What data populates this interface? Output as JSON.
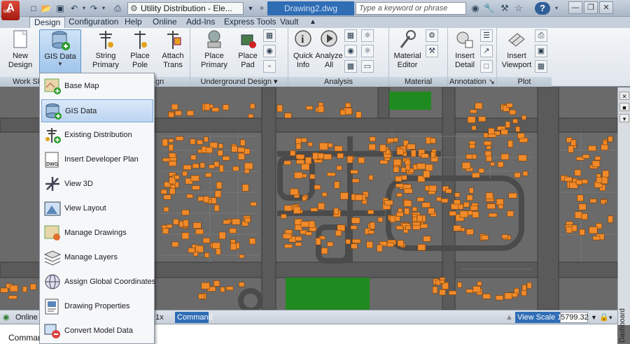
{
  "titlebar": {
    "app_initial": "A",
    "app_code": "UID",
    "file_title": "Utility Distribution - Ele...",
    "drawing_name": "Drawing2.dwg",
    "search_placeholder": "Type a keyword or phrase"
  },
  "tabs": [
    "Design",
    "Configuration",
    "Help",
    "Online",
    "Add-Ins",
    "Express Tools",
    "Vault"
  ],
  "active_tab": "Design",
  "ribbon": {
    "panels": {
      "work": "Work Sk",
      "work_tail": "gn",
      "underground": "Underground Design",
      "analysis": "Analysis",
      "material": "Material",
      "annotation": "Annotation",
      "plot": "Plot"
    },
    "buttons": {
      "new_design": [
        "New",
        "Design"
      ],
      "gis_data": "GIS Data",
      "string_primary": [
        "String",
        "Primary"
      ],
      "place_pole": [
        "Place",
        "Pole"
      ],
      "attach_trans": [
        "Attach",
        "Trans"
      ],
      "place_primary": [
        "Place",
        "Primary"
      ],
      "place_pad": [
        "Place",
        "Pad"
      ],
      "quick_info": [
        "Quick",
        "Info"
      ],
      "analyze_all": [
        "Analyze",
        "All"
      ],
      "material_editor": [
        "Material",
        "Editor"
      ],
      "insert_detail": [
        "Insert",
        "Detail"
      ],
      "insert_viewport": [
        "Insert",
        "Viewport"
      ]
    }
  },
  "gis_menu": [
    {
      "label": "Base Map",
      "icon": "base-map-icon"
    },
    {
      "label": "GIS Data",
      "icon": "gis-data-icon"
    },
    {
      "label": "Existing Distribution",
      "icon": "existing-distribution-icon"
    },
    {
      "label": "Insert Developer Plan",
      "icon": "dwg-icon"
    },
    {
      "label": "View 3D",
      "icon": "view-3d-icon"
    },
    {
      "label": "View Layout",
      "icon": "view-layout-icon"
    },
    {
      "label": "Manage Drawings",
      "icon": "manage-drawings-icon"
    },
    {
      "label": "Manage Layers",
      "icon": "layers-icon"
    },
    {
      "label": "Assign Global Coordinates",
      "icon": "globe-icon"
    },
    {
      "label": "Drawing Properties",
      "icon": "drawing-properties-icon"
    },
    {
      "label": "Convert Model Data",
      "icon": "convert-model-icon"
    }
  ],
  "gis_menu_selected": "GIS Data",
  "statusbar": {
    "online": "Online",
    "zoom": "1x",
    "command_tab": "Command",
    "view_scale_label": "View Scale",
    "view_scale_prefix": "1:",
    "view_scale_value": "5799.32"
  },
  "command_line": {
    "label": "Command"
  },
  "side_panel": {
    "label": "Dashboard"
  },
  "colors": {
    "map_background": "#6a6a6a",
    "building": "#f08a2a",
    "park": "#1f8a1f",
    "accent_blue": "#2f6db5"
  }
}
